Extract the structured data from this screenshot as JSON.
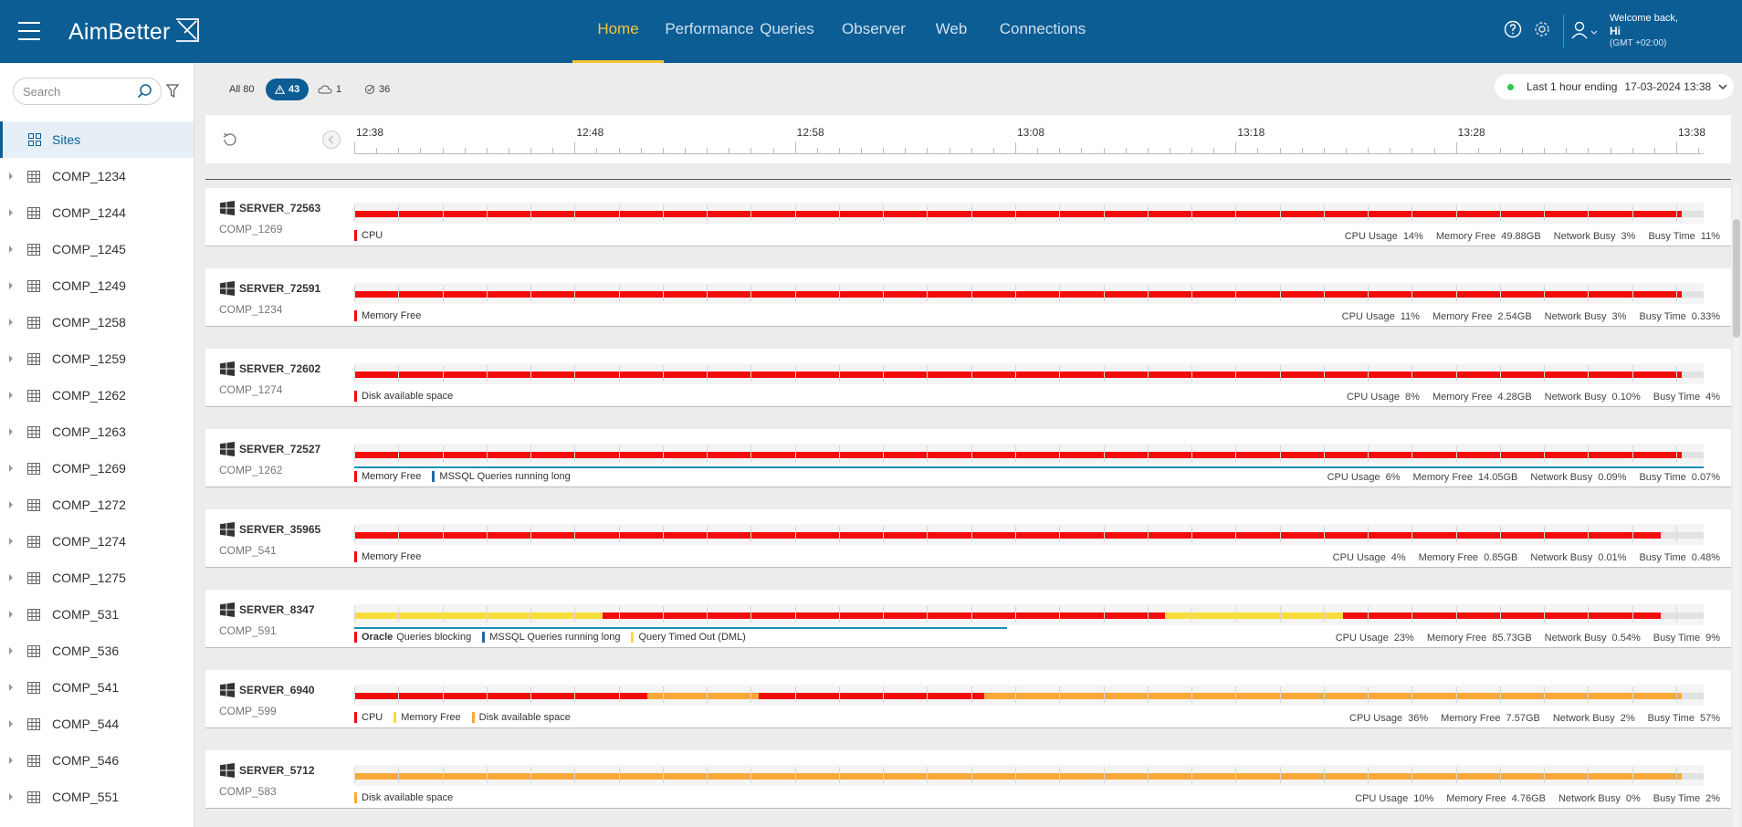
{
  "header": {
    "brand": "AimBetter",
    "nav": [
      {
        "label": "Home",
        "active": true
      },
      {
        "label": "Performance"
      },
      {
        "label": "Queries"
      },
      {
        "label": "Observer"
      },
      {
        "label": "Web"
      },
      {
        "label": "Connections"
      }
    ],
    "welcome": "Welcome back,",
    "user": "Hi",
    "timezone": "(GMT +02:00)"
  },
  "sidebar": {
    "search_placeholder": "Search",
    "sites_label": "Sites",
    "items": [
      "COMP_1234",
      "COMP_1244",
      "COMP_1245",
      "COMP_1249",
      "COMP_1258",
      "COMP_1259",
      "COMP_1262",
      "COMP_1263",
      "COMP_1269",
      "COMP_1272",
      "COMP_1274",
      "COMP_1275",
      "COMP_531",
      "COMP_536",
      "COMP_541",
      "COMP_544",
      "COMP_546",
      "COMP_551"
    ]
  },
  "filters": {
    "all_label": "All",
    "all_count": "80",
    "warn_count": "43",
    "cloud_count": "1",
    "check_count": "36"
  },
  "timerange": {
    "label": "Last 1 hour ending",
    "end": "17-03-2024 13:38"
  },
  "timeline": {
    "ticks": [
      "12:38",
      "12:48",
      "12:58",
      "13:08",
      "13:18",
      "13:28",
      "13:38"
    ]
  },
  "colors": {
    "red": "#f20c0c",
    "yellow": "#f9dd3c",
    "orange": "#f9a83a",
    "blue": "#1f6aa8",
    "teal": "#1a8fb9",
    "brand": "#0c5d94"
  },
  "metric_labels": {
    "cpu": "CPU Usage",
    "mem": "Memory Free",
    "net": "Network Busy",
    "busy": "Busy Time"
  },
  "servers": [
    {
      "name": "SERVER_72563",
      "comp": "COMP_1269",
      "segments": [
        {
          "from": 0,
          "to": 0.984,
          "color": "red"
        }
      ],
      "legend": [
        {
          "color": "red",
          "label": "CPU"
        }
      ],
      "metrics": {
        "cpu": "14%",
        "mem": "49.88GB",
        "net": "3%",
        "busy": "11%"
      }
    },
    {
      "name": "SERVER_72591",
      "comp": "COMP_1234",
      "segments": [
        {
          "from": 0,
          "to": 0.984,
          "color": "red"
        }
      ],
      "legend": [
        {
          "color": "red",
          "label": "Memory Free"
        }
      ],
      "metrics": {
        "cpu": "11%",
        "mem": "2.54GB",
        "net": "3%",
        "busy": "0.33%"
      }
    },
    {
      "name": "SERVER_72602",
      "comp": "COMP_1274",
      "segments": [
        {
          "from": 0,
          "to": 0.984,
          "color": "red"
        }
      ],
      "legend": [
        {
          "color": "red",
          "label": "Disk available space"
        }
      ],
      "metrics": {
        "cpu": "8%",
        "mem": "4.28GB",
        "net": "0.10%",
        "busy": "4%"
      }
    },
    {
      "name": "SERVER_72527",
      "comp": "COMP_1262",
      "segments": [
        {
          "from": 0,
          "to": 0.984,
          "color": "red"
        }
      ],
      "subline": 1.0,
      "legend": [
        {
          "color": "red",
          "label": "Memory Free"
        },
        {
          "color": "blue",
          "label": "MSSQL Queries running long"
        }
      ],
      "metrics": {
        "cpu": "6%",
        "mem": "14.05GB",
        "net": "0.09%",
        "busy": "0.07%"
      }
    },
    {
      "name": "SERVER_35965",
      "comp": "COMP_541",
      "segments": [
        {
          "from": 0,
          "to": 0.968,
          "color": "red"
        }
      ],
      "legend": [
        {
          "color": "red",
          "label": "Memory Free"
        }
      ],
      "metrics": {
        "cpu": "4%",
        "mem": "0.85GB",
        "net": "0.01%",
        "busy": "0.48%"
      }
    },
    {
      "name": "SERVER_8347",
      "comp": "COMP_591",
      "segments": [
        {
          "from": 0,
          "to": 0.184,
          "color": "yellow"
        },
        {
          "from": 0.184,
          "to": 0.601,
          "color": "red"
        },
        {
          "from": 0.601,
          "to": 0.733,
          "color": "yellow"
        },
        {
          "from": 0.733,
          "to": 0.968,
          "color": "red"
        }
      ],
      "subline": 0.484,
      "legend": [
        {
          "color": "red",
          "label": "Queries blocking",
          "prefix": "Oracle"
        },
        {
          "color": "blue",
          "label": "MSSQL Queries running long"
        },
        {
          "color": "yellow",
          "label": "Query Timed Out (DML)"
        }
      ],
      "metrics": {
        "cpu": "23%",
        "mem": "85.73GB",
        "net": "0.54%",
        "busy": "9%"
      }
    },
    {
      "name": "SERVER_6940",
      "comp": "COMP_599",
      "segments": [
        {
          "from": 0,
          "to": 0.217,
          "color": "red"
        },
        {
          "from": 0.217,
          "to": 0.3,
          "color": "orange"
        },
        {
          "from": 0.3,
          "to": 0.467,
          "color": "red"
        },
        {
          "from": 0.467,
          "to": 0.984,
          "color": "orange"
        }
      ],
      "legend": [
        {
          "color": "red",
          "label": "CPU"
        },
        {
          "color": "yellow",
          "label": "Memory Free"
        },
        {
          "color": "orange",
          "label": "Disk available space"
        }
      ],
      "metrics": {
        "cpu": "36%",
        "mem": "7.57GB",
        "net": "2%",
        "busy": "57%"
      }
    },
    {
      "name": "SERVER_5712",
      "comp": "COMP_583",
      "segments": [
        {
          "from": 0,
          "to": 0.984,
          "color": "orange"
        }
      ],
      "legend": [
        {
          "color": "orange",
          "label": "Disk available space"
        }
      ],
      "metrics": {
        "cpu": "10%",
        "mem": "4.76GB",
        "net": "0%",
        "busy": "2%"
      }
    }
  ]
}
